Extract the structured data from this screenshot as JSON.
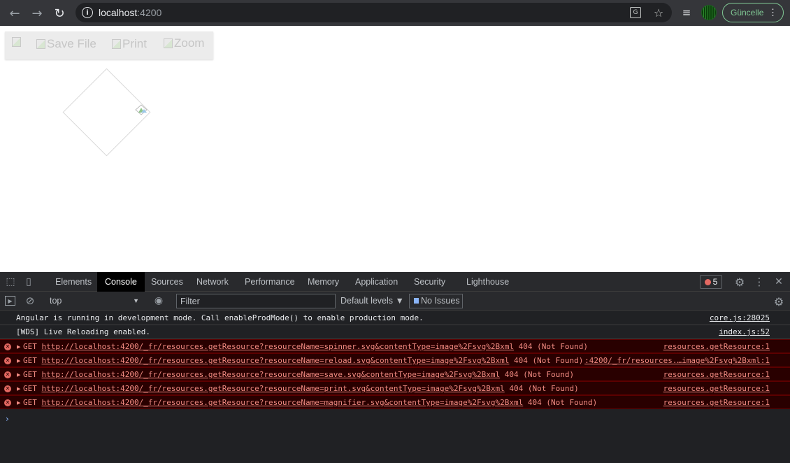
{
  "browser": {
    "back_icon": "←",
    "forward_icon": "→",
    "reload_icon": "↻",
    "url_host": "localhost",
    "url_port": ":4200",
    "translate_icon": "G",
    "star_icon": "☆",
    "playlist_icon": "≡",
    "update_label": "Güncelle",
    "menu_icon": "⋮",
    "info_icon": "i"
  },
  "app": {
    "toolbar": {
      "save_alt": "Save File",
      "print_alt": "Print",
      "zoom_alt": "Zoom"
    }
  },
  "devtools": {
    "inspect_icon": "⬚",
    "device_icon": "▯",
    "tabs": [
      "Elements",
      "Console",
      "Sources",
      "Network",
      "Performance",
      "Memory",
      "Application",
      "Security",
      "Lighthouse"
    ],
    "active_tab": "Console",
    "error_count": "5",
    "settings_icon": "⚙",
    "menu_icon": "⋮",
    "close_icon": "✕",
    "sidebar_icon": "▶",
    "clear_icon": "⊘",
    "context": "top",
    "context_arrow": "▼",
    "eye_icon": "◉",
    "filter_placeholder": "Filter",
    "levels_label": "Default levels ▼",
    "issues_label": "No Issues",
    "console_settings_icon": "⚙",
    "prompt": "›",
    "messages": [
      {
        "type": "info",
        "text": "Angular is running in development mode. Call enableProdMode() to enable production mode.",
        "source": "core.js:28025"
      },
      {
        "type": "info",
        "text": "[WDS] Live Reloading enabled.",
        "source": "index.js:52"
      },
      {
        "type": "error",
        "method": "GET",
        "url": "http://localhost:4200/_fr/resources.getResource?resourceName=spinner.svg&contentType=image%2Fsvg%2Bxml",
        "status": "404 (Not Found)",
        "source": "resources.getResource:1"
      },
      {
        "type": "error",
        "method": "GET",
        "url": "http://localhost:4200/_fr/resources.getResource?resourceName=reload.svg&contentType=image%2Fsvg%2Bxml",
        "status": "404 (Not Found)",
        "source": ":4200/_fr/resources.…image%2Fsvg%2Bxml:1"
      },
      {
        "type": "error",
        "method": "GET",
        "url": "http://localhost:4200/_fr/resources.getResource?resourceName=save.svg&contentType=image%2Fsvg%2Bxml",
        "status": "404 (Not Found)",
        "source": "resources.getResource:1"
      },
      {
        "type": "error",
        "method": "GET",
        "url": "http://localhost:4200/_fr/resources.getResource?resourceName=print.svg&contentType=image%2Fsvg%2Bxml",
        "status": "404 (Not Found)",
        "source": "resources.getResource:1"
      },
      {
        "type": "error",
        "method": "GET",
        "url": "http://localhost:4200/_fr/resources.getResource?resourceName=magnifier.svg&contentType=image%2Fsvg%2Bxml",
        "status": "404 (Not Found)",
        "source": "resources.getResource:1"
      }
    ]
  }
}
